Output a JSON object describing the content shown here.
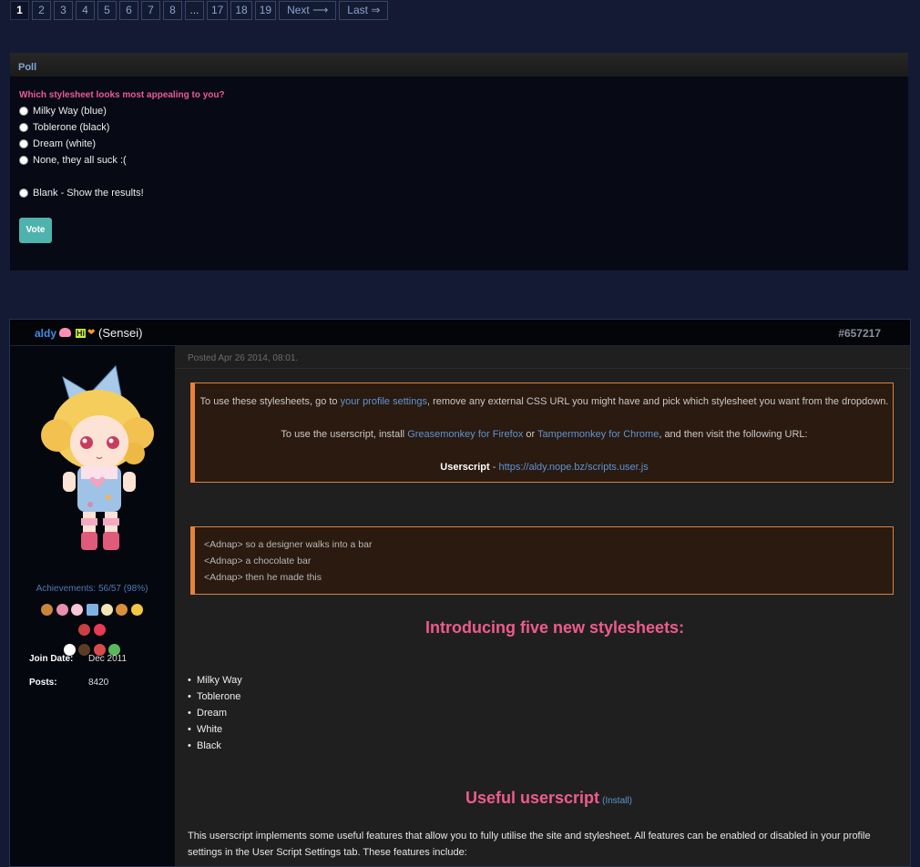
{
  "pagination": {
    "pages": [
      "1",
      "2",
      "3",
      "4",
      "5",
      "6",
      "7",
      "8",
      "...",
      "17",
      "18",
      "19"
    ],
    "next": "Next ⟶",
    "last": "Last ⇒",
    "current": "1"
  },
  "poll": {
    "header": "Poll",
    "question": "Which stylesheet looks most appealing to you?",
    "options": [
      "Milky Way (blue)",
      "Toblerone (black)",
      "Dream (white)",
      "None, they all suck :("
    ],
    "blank_option": "Blank - Show the results!",
    "vote_label": "Vote"
  },
  "post": {
    "username": "aldy",
    "badge_hi": "Hi",
    "user_title": "(Sensei)",
    "post_id": "#657217",
    "posted": "Posted Apr 26 2014, 08:01.",
    "achievements": "Achievements: 56/57 (98%)",
    "join_label": "Join Date:",
    "join_value": "Dec 2011",
    "posts_label": "Posts:",
    "posts_value": "8420",
    "notice": {
      "line1_pre": "To use these stylesheets, go to ",
      "line1_link": "your profile settings",
      "line1_post": ", remove any external CSS URL you might have and pick which stylesheet you want from the dropdown.",
      "line2_pre": "To use the userscript, install ",
      "line2_link1": "Greasemonkey for Firefox",
      "line2_mid": " or ",
      "line2_link2": "Tampermonkey for Chrome",
      "line2_post": ", and then visit the following URL:",
      "line3_label": "Userscript",
      "line3_sep": " - ",
      "line3_link": "https://aldy.nope.bz/scripts.user.js"
    },
    "quote_lines": [
      "<Adnap> so a designer walks into a bar",
      "<Adnap> a chocolate bar",
      "<Adnap> then he made this"
    ],
    "heading1": "Introducing five new stylesheets:",
    "stylesheets": [
      "Milky Way",
      "Toblerone",
      "Dream",
      "White",
      "Black"
    ],
    "heading2": "Useful userscript",
    "install_link": "(Install)",
    "paragraph": "This userscript implements some useful features that allow you to fully utilise the site and stylesheet. All features can be enabled or disabled in your profile settings in the User Script Settings tab. These features include:"
  },
  "colors": {
    "background": "#141a33",
    "accent_pink": "#ee5b8f",
    "link_blue": "#5f94d1",
    "vote_teal": "#4eb3ac",
    "notice_border": "#e8823a"
  }
}
